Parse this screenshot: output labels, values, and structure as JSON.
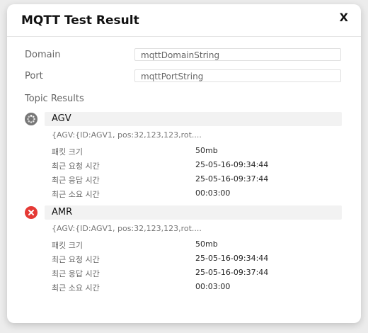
{
  "dialog": {
    "title": "MQTT Test Result",
    "close_label": "X"
  },
  "form": {
    "domain_label": "Domain",
    "domain_value": "mqttDomainString",
    "port_label": "Port",
    "port_value": "mqttPortString"
  },
  "topic_results_label": "Topic Results",
  "topics": [
    {
      "status": "pending",
      "status_icon": "loading-icon",
      "name": "AGV",
      "payload": "{AGV:{ID:AGV1, pos:32,123,123,rot....",
      "details": [
        {
          "key": "패킷 크기",
          "value": "50mb"
        },
        {
          "key": "최근 요청 시간",
          "value": "25-05-16-09:34:44"
        },
        {
          "key": "최근 응답 시간",
          "value": "25-05-16-09:37:44"
        },
        {
          "key": "최근 소요 시간",
          "value": "00:03:00"
        }
      ]
    },
    {
      "status": "error",
      "status_icon": "error-x-icon",
      "status_color": "#e53935",
      "name": "AMR",
      "payload": "{AGV:{ID:AGV1, pos:32,123,123,rot....",
      "details": [
        {
          "key": "패킷 크기",
          "value": "50mb"
        },
        {
          "key": "최근 요청 시간",
          "value": "25-05-16-09:34:44"
        },
        {
          "key": "최근 응답 시간",
          "value": "25-05-16-09:37:44"
        },
        {
          "key": "최근 소요 시간",
          "value": "00:03:00"
        }
      ]
    }
  ]
}
